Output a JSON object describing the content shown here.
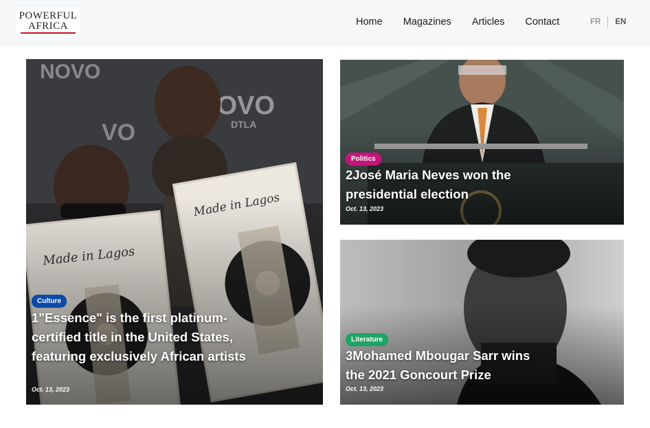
{
  "brand": {
    "line1": "POWERFUL",
    "line2": "AFRICA"
  },
  "nav": {
    "items": [
      "Home",
      "Magazines",
      "Articles",
      "Contact"
    ]
  },
  "lang": {
    "fr": "FR",
    "en": "EN"
  },
  "articles": [
    {
      "category": "Culture",
      "category_color": "#0b4aa8",
      "title": "1\"Essence\" is the first platinum-certified title in the United States, featuring exclusively African artists",
      "date": "Oct. 13, 2023",
      "photo": "two-artists-holding-platinum-plaques-image",
      "plaque_text": "Made in Lagos",
      "backdrop_text": "NOVO DTLA"
    },
    {
      "category": "Politics",
      "category_color": "#c21679",
      "title": "2José Maria Neves won the presidential election",
      "date": "Oct. 13, 2023",
      "photo": "man-speaking-at-podium-image"
    },
    {
      "category": "Literature",
      "category_color": "#1fa463",
      "title": "3Mohamed Mbougar Sarr wins the 2021 Goncourt Prize",
      "date": "Oct. 13, 2023",
      "photo": "black-and-white-portrait-image"
    }
  ]
}
